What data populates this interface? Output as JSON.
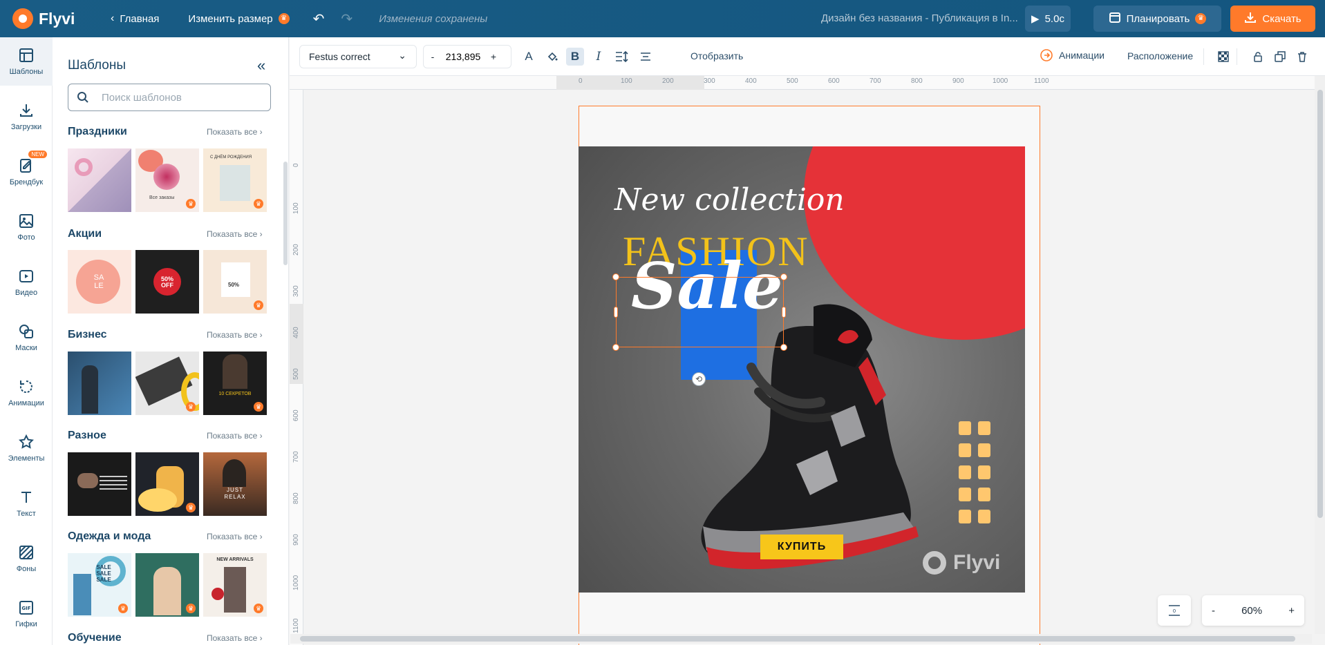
{
  "topbar": {
    "logo": "Flyvi",
    "home": "Главная",
    "resize": "Изменить размер",
    "saved": "Изменения сохранены",
    "doc_title": "Дизайн без названия - Публикация в In...",
    "duration": "5.0с",
    "plan": "Планировать",
    "download": "Скачать",
    "crown_icon": "crown-icon"
  },
  "rail": [
    {
      "label": "Шаблоны",
      "icon": "templates-icon"
    },
    {
      "label": "Загрузки",
      "icon": "upload-icon"
    },
    {
      "label": "Брендбук",
      "icon": "brandbook-icon",
      "badge": "NEW"
    },
    {
      "label": "Фото",
      "icon": "photo-icon"
    },
    {
      "label": "Видео",
      "icon": "video-icon"
    },
    {
      "label": "Маски",
      "icon": "masks-icon"
    },
    {
      "label": "Анимации",
      "icon": "animation-icon"
    },
    {
      "label": "Элементы",
      "icon": "star-icon"
    },
    {
      "label": "Текст",
      "icon": "text-icon"
    },
    {
      "label": "Фоны",
      "icon": "backgrounds-icon"
    },
    {
      "label": "Гифки",
      "icon": "gif-icon"
    }
  ],
  "panel": {
    "title": "Шаблоны",
    "search_placeholder": "Поиск шаблонов",
    "show_all": "Показать все",
    "sections": [
      {
        "title": "Праздники",
        "thumb_texts": [
          "",
          "Все заказы",
          "С ДНЁМ РОЖДЕНИЯ"
        ]
      },
      {
        "title": "Акции",
        "thumb_texts": [
          "SA LE",
          "50% OFF",
          "50%"
        ]
      },
      {
        "title": "Бизнес",
        "thumb_texts": [
          "",
          "",
          "10 СЕКРЕТОВ"
        ]
      },
      {
        "title": "Разное",
        "thumb_texts": [
          "",
          "",
          "JUST RELAX"
        ]
      },
      {
        "title": "Одежда и мода",
        "thumb_texts": [
          "SALE SALE SALE",
          "",
          "NEW ARRIVALS"
        ]
      },
      {
        "title": "Обучение"
      }
    ]
  },
  "toolbar": {
    "font": "Festus correct",
    "font_size": "213,895",
    "minus": "-",
    "plus": "+",
    "mirror": "Отобразить",
    "animations": "Анимации",
    "position": "Расположение"
  },
  "ruler": {
    "h": [
      "0",
      "100",
      "200",
      "300",
      "400",
      "500",
      "600",
      "700",
      "800",
      "900",
      "1000",
      "1100"
    ],
    "v": [
      "0",
      "100",
      "200",
      "300",
      "400",
      "500",
      "600",
      "700",
      "800",
      "900",
      "1000",
      "1100"
    ]
  },
  "design": {
    "line1": "New collection",
    "line2": "FASHION",
    "line3": "Sale",
    "buy": "КУПИТЬ",
    "watermark": "Flyvi",
    "colors": {
      "accent": "#ff7a2a",
      "yellow": "#f3c21a",
      "blue": "#1e6fe2",
      "red": "#e53238"
    }
  },
  "zoom": {
    "minus": "-",
    "value": "60%",
    "plus": "+",
    "fit": "0"
  }
}
